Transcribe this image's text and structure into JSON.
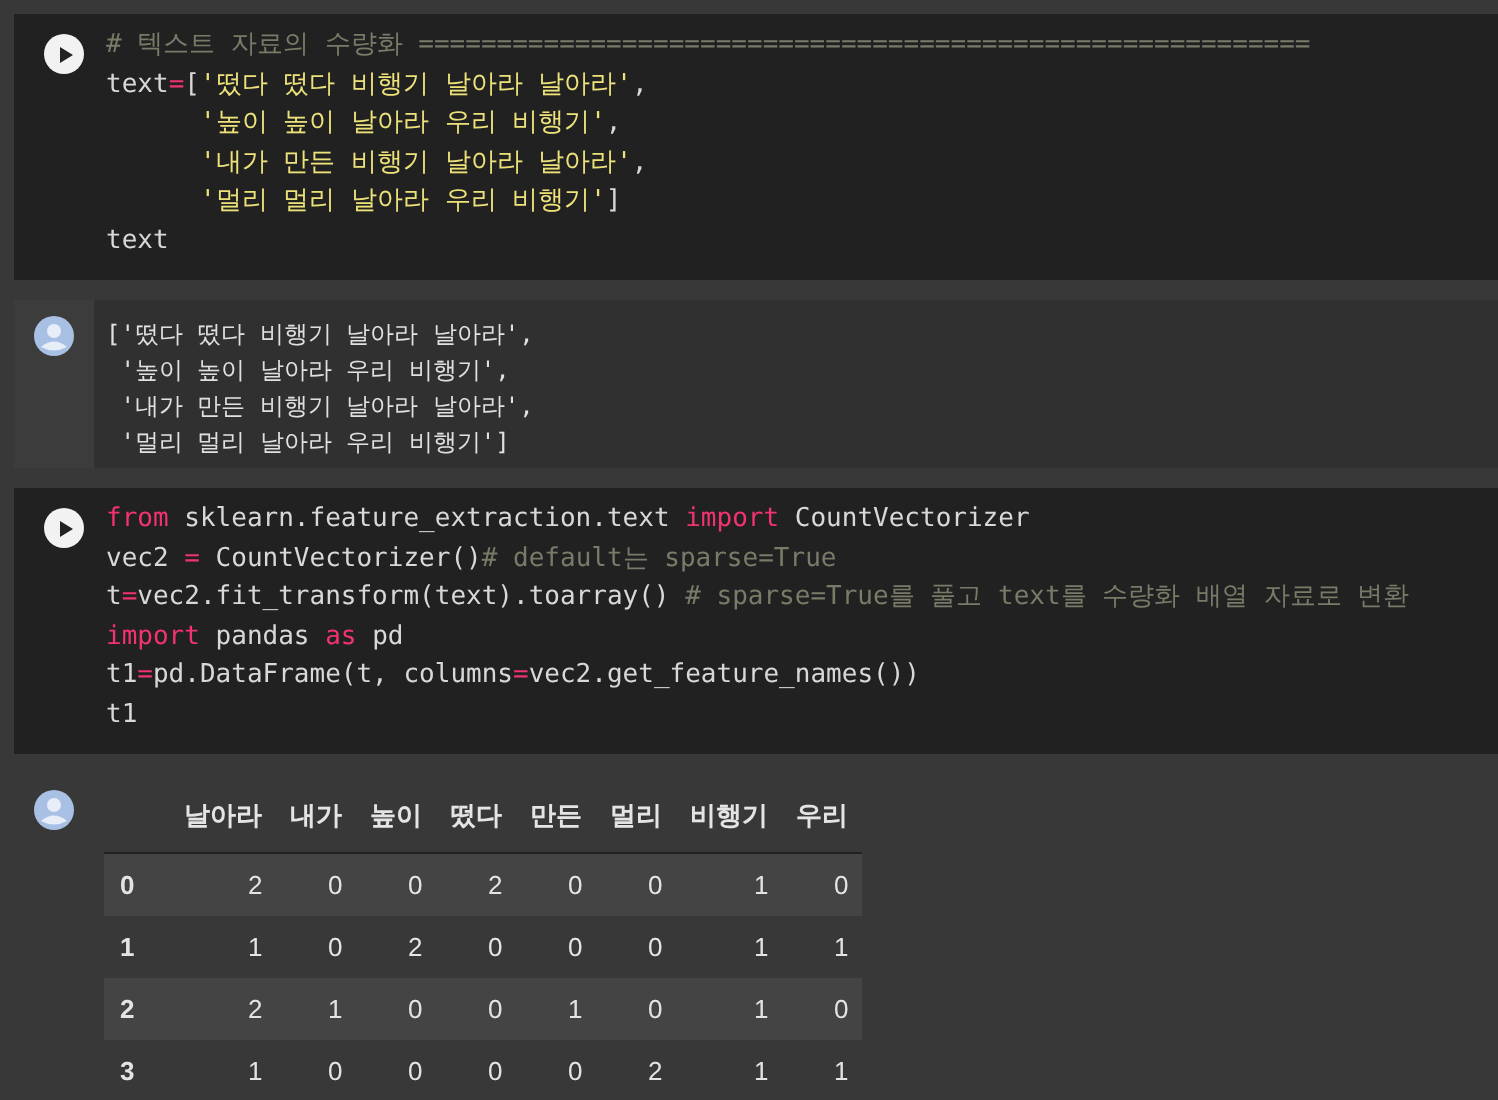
{
  "cells": [
    {
      "kind": "code",
      "lines": [
        [
          {
            "kind": "comment",
            "text": "# 텍스트 자료의 수량화 ========================================================="
          }
        ],
        [
          {
            "kind": "plain",
            "text": "text"
          },
          {
            "kind": "op",
            "text": "="
          },
          {
            "kind": "plain",
            "text": "["
          },
          {
            "kind": "string",
            "text": "'떴다 떴다 비행기 날아라 날아라'"
          },
          {
            "kind": "plain",
            "text": ","
          }
        ],
        [
          {
            "kind": "indent"
          },
          {
            "kind": "string",
            "text": "'높이 높이 날아라 우리 비행기'"
          },
          {
            "kind": "plain",
            "text": ","
          }
        ],
        [
          {
            "kind": "indent"
          },
          {
            "kind": "string",
            "text": "'내가 만든 비행기 날아라 날아라'"
          },
          {
            "kind": "plain",
            "text": ","
          }
        ],
        [
          {
            "kind": "indent"
          },
          {
            "kind": "string",
            "text": "'멀리 멀리 날아라 우리 비행기'"
          },
          {
            "kind": "plain",
            "text": "]"
          }
        ],
        [
          {
            "kind": "plain",
            "text": "text"
          }
        ]
      ]
    },
    {
      "kind": "text_output",
      "lines": [
        "['떴다 떴다 비행기 날아라 날아라',",
        " '높이 높이 날아라 우리 비행기',",
        " '내가 만든 비행기 날아라 날아라',",
        " '멀리 멀리 날아라 우리 비행기']"
      ]
    },
    {
      "kind": "code",
      "lines": [
        [
          {
            "kind": "keyword",
            "text": "from"
          },
          {
            "kind": "plain",
            "text": " sklearn.feature_extraction.text "
          },
          {
            "kind": "keyword",
            "text": "import"
          },
          {
            "kind": "plain",
            "text": " CountVectorizer"
          }
        ],
        [
          {
            "kind": "plain",
            "text": "vec2 "
          },
          {
            "kind": "op",
            "text": "="
          },
          {
            "kind": "plain",
            "text": " CountVectorizer()"
          },
          {
            "kind": "comment",
            "text": "# default는 sparse=True"
          }
        ],
        [
          {
            "kind": "plain",
            "text": "t"
          },
          {
            "kind": "op",
            "text": "="
          },
          {
            "kind": "plain",
            "text": "vec2.fit_transform(text).toarray() "
          },
          {
            "kind": "comment",
            "text": "# sparse=True를 풀고 text를 수량화 배열 자료로 변환"
          }
        ],
        [
          {
            "kind": "keyword",
            "text": "import"
          },
          {
            "kind": "plain",
            "text": " pandas "
          },
          {
            "kind": "keyword",
            "text": "as"
          },
          {
            "kind": "plain",
            "text": " pd"
          }
        ],
        [
          {
            "kind": "plain",
            "text": "t1"
          },
          {
            "kind": "op",
            "text": "="
          },
          {
            "kind": "plain",
            "text": "pd.DataFrame(t, columns"
          },
          {
            "kind": "op",
            "text": "="
          },
          {
            "kind": "plain",
            "text": "vec2.get_feature_names())"
          }
        ],
        [
          {
            "kind": "plain",
            "text": "t1"
          }
        ]
      ]
    },
    {
      "kind": "table_output",
      "columns": [
        "날아라",
        "내가",
        "높이",
        "떴다",
        "만든",
        "멀리",
        "비행기",
        "우리"
      ],
      "rows": [
        {
          "index": "0",
          "values": [
            "2",
            "0",
            "0",
            "2",
            "0",
            "0",
            "1",
            "0"
          ]
        },
        {
          "index": "1",
          "values": [
            "1",
            "0",
            "2",
            "0",
            "0",
            "0",
            "1",
            "1"
          ]
        },
        {
          "index": "2",
          "values": [
            "2",
            "1",
            "0",
            "0",
            "1",
            "0",
            "1",
            "0"
          ]
        },
        {
          "index": "3",
          "values": [
            "1",
            "0",
            "0",
            "0",
            "0",
            "2",
            "1",
            "1"
          ]
        }
      ]
    }
  ]
}
